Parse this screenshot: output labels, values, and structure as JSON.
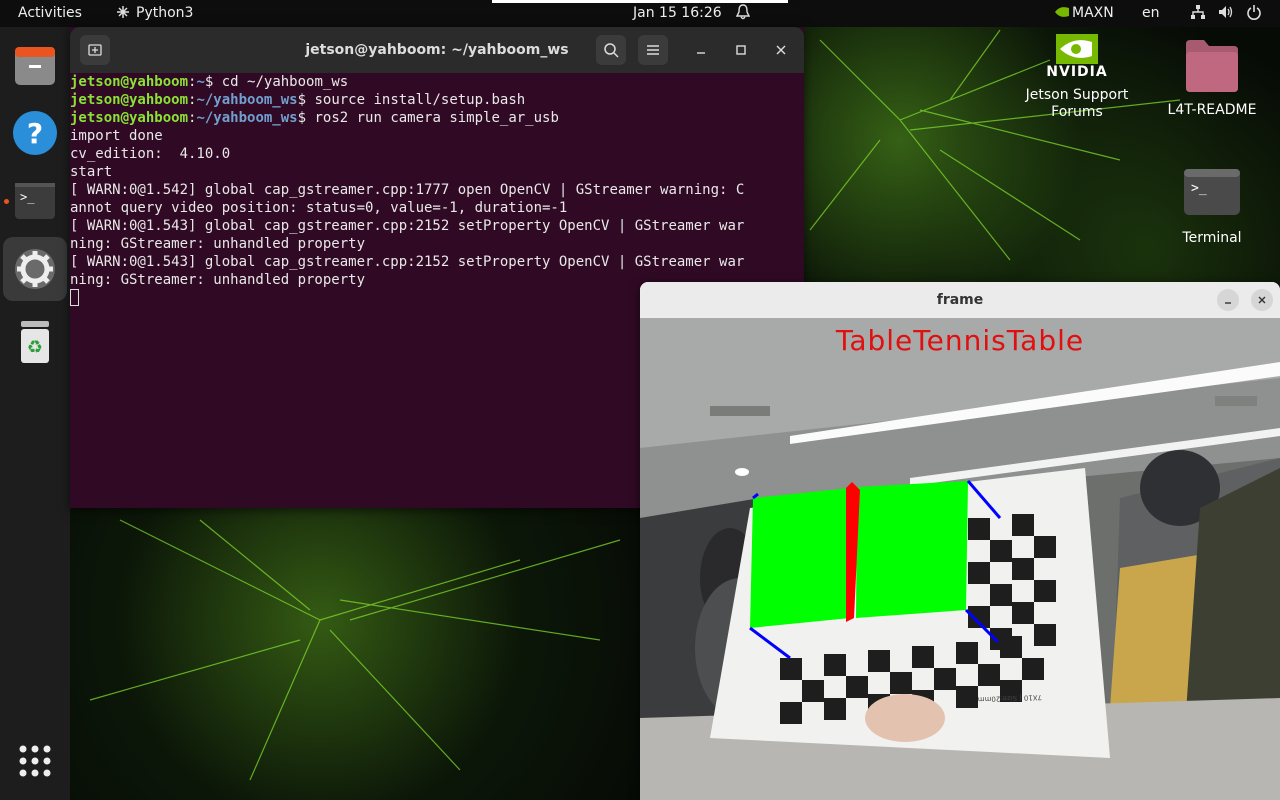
{
  "topbar": {
    "activities": "Activities",
    "app_name": "Python3",
    "datetime": "Jan 15  16:26",
    "power_mode": "MAXN",
    "language": "en"
  },
  "dock": {
    "items": [
      "files",
      "help",
      "terminal",
      "settings",
      "trash"
    ]
  },
  "terminal": {
    "title": "jetson@yahboom: ~/yahboom_ws",
    "prompt_user": "jetson@yahboom",
    "lines": {
      "l1_path": "~",
      "l1_cmd": "$ cd ~/yahboom_ws",
      "l2_path": "~/yahboom_ws",
      "l2_cmd": "$ source install/setup.bash",
      "l3_path": "~/yahboom_ws",
      "l3_cmd": "$ ros2 run camera simple_ar_usb",
      "l4": "import done",
      "l5": "cv_edition:  4.10.0",
      "l6": "start",
      "l7": "[ WARN:0@1.542] global cap_gstreamer.cpp:1777 open OpenCV | GStreamer warning: C",
      "l8": "annot query video position: status=0, value=-1, duration=-1",
      "l9": "[ WARN:0@1.543] global cap_gstreamer.cpp:2152 setProperty OpenCV | GStreamer war",
      "l10": "ning: GStreamer: unhandled property",
      "l11": "[ WARN:0@1.543] global cap_gstreamer.cpp:2152 setProperty OpenCV | GStreamer war",
      "l12": "ning: GStreamer: unhandled property"
    }
  },
  "desktop": {
    "nvidia_logo_text": "NVIDIA",
    "nvidia_label_1": "Jetson Support",
    "nvidia_label_2": "Forums",
    "readme_label": "L4T-README",
    "terminal_label": "Terminal"
  },
  "frame_window": {
    "title": "frame",
    "overlay_text": "TableTennisTable",
    "board_label": "7X10 | Size:20mm"
  },
  "colors": {
    "terminal_bg": "#300a24",
    "prompt_user": "#8ae234",
    "prompt_path": "#729fcf",
    "ar_plane": "#00ff00",
    "ar_edge": "#ff0000",
    "ar_axis": "#0000ff",
    "overlay_text": "#e01010"
  }
}
